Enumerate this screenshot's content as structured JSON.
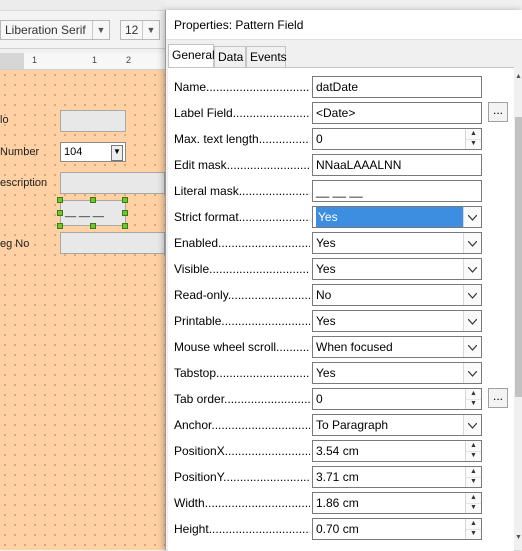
{
  "background": {
    "font_name": "Liberation Serif",
    "font_size": "12",
    "ruler_marks": [
      "1",
      "1",
      "2"
    ],
    "form": {
      "labels": [
        "lo",
        "Number",
        "escription",
        "eg No"
      ],
      "number_value": "104",
      "selected_field_text": "__ __ __"
    }
  },
  "dialog": {
    "title": "Properties: Pattern Field",
    "tabs": [
      "General",
      "Data",
      "Events"
    ],
    "ellipsis": "...",
    "rows": [
      {
        "label": "Name",
        "value": ""
      },
      {
        "label": "Label Field",
        "value": "<Date>"
      },
      {
        "label": "Max. text length",
        "value": "0"
      },
      {
        "label": "Edit mask",
        "value": "NNaaLAAALNN"
      },
      {
        "label": "Literal mask",
        "value": "__ __ __"
      },
      {
        "label": "Strict format",
        "value": "Yes"
      },
      {
        "label": "Enabled",
        "value": "Yes"
      },
      {
        "label": "Visible",
        "value": "Yes"
      },
      {
        "label": "Read-only",
        "value": "No"
      },
      {
        "label": "Printable",
        "value": "Yes"
      },
      {
        "label": "Mouse wheel scroll",
        "value": "When focused"
      },
      {
        "label": "Tabstop",
        "value": "Yes"
      },
      {
        "label": "Tab order",
        "value": "0"
      },
      {
        "label": "Anchor",
        "value": "To Paragraph"
      },
      {
        "label": "PositionX",
        "value": "3.54 cm"
      },
      {
        "label": "PositionY",
        "value": "3.71 cm"
      },
      {
        "label": "Width",
        "value": "1.86 cm"
      },
      {
        "label": "Height",
        "value": "0.70 cm"
      }
    ],
    "name_value": "datDate"
  },
  "colors": {
    "selection": "#3d8ee0",
    "form_bg": "#ffd1a4",
    "handle": "#6fc52c"
  }
}
